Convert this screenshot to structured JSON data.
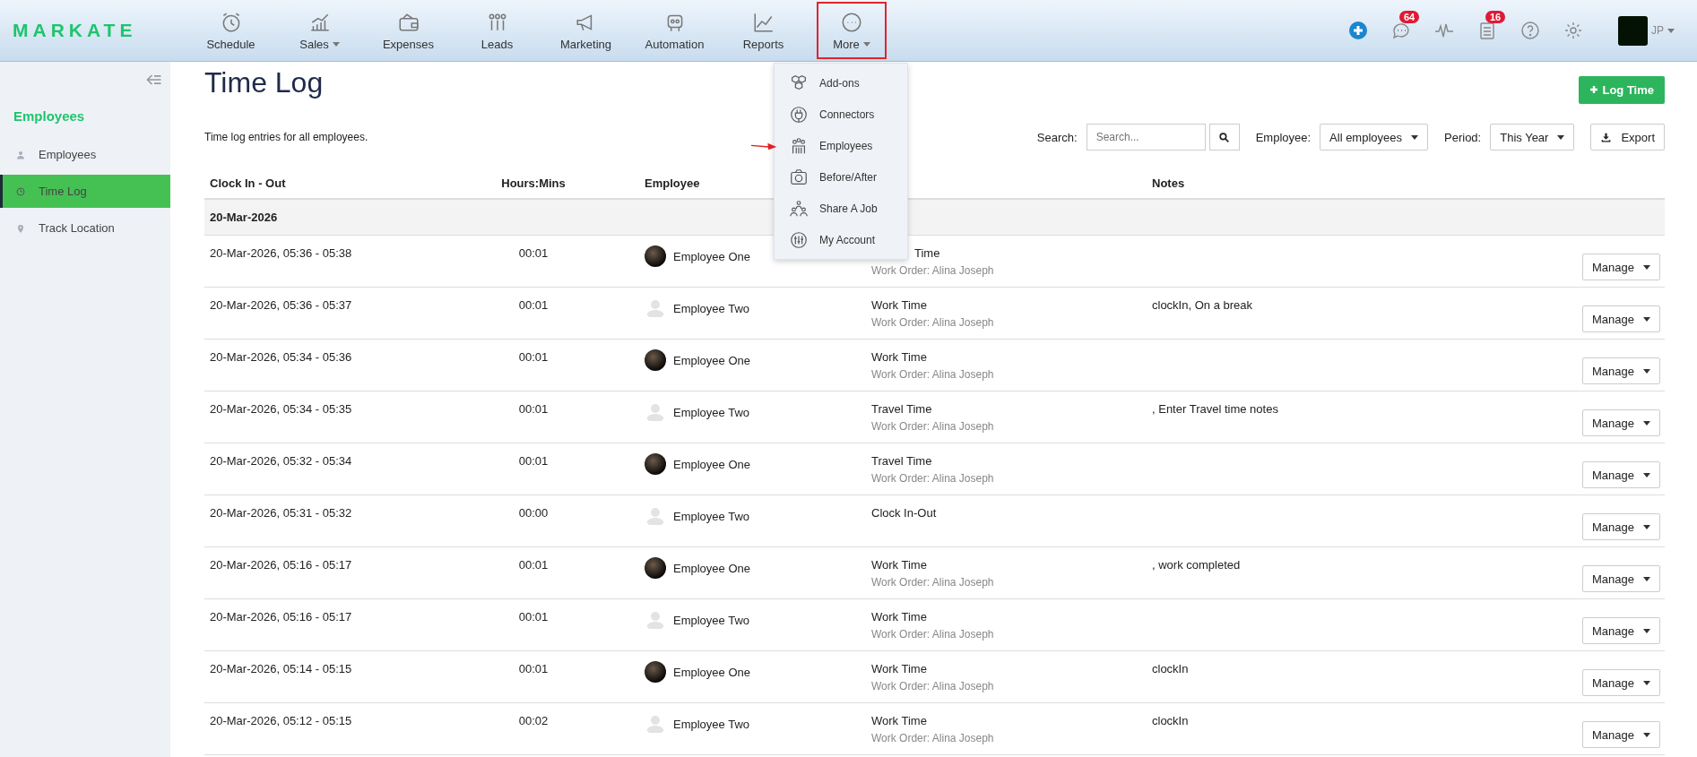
{
  "logo": "MARKATE",
  "nav": [
    {
      "label": "Schedule",
      "dropdown": false,
      "highlighted": false
    },
    {
      "label": "Sales",
      "dropdown": true,
      "highlighted": false
    },
    {
      "label": "Expenses",
      "dropdown": false,
      "highlighted": false
    },
    {
      "label": "Leads",
      "dropdown": false,
      "highlighted": false
    },
    {
      "label": "Marketing",
      "dropdown": false,
      "highlighted": false
    },
    {
      "label": "Automation",
      "dropdown": false,
      "highlighted": false
    },
    {
      "label": "Reports",
      "dropdown": false,
      "highlighted": false
    },
    {
      "label": "More",
      "dropdown": true,
      "highlighted": true
    }
  ],
  "header_right": {
    "chat_badge": "64",
    "tasks_badge": "16",
    "user": "JP"
  },
  "more_menu": [
    {
      "label": "Add-ons",
      "pointed": false
    },
    {
      "label": "Connectors",
      "pointed": false
    },
    {
      "label": "Employees",
      "pointed": true
    },
    {
      "label": "Before/After",
      "pointed": false
    },
    {
      "label": "Share A Job",
      "pointed": false
    },
    {
      "label": "My Account",
      "pointed": false
    }
  ],
  "sidebar": {
    "title": "Employees",
    "items": [
      {
        "label": "Employees",
        "selected": false
      },
      {
        "label": "Time Log",
        "selected": true
      },
      {
        "label": "Track Location",
        "selected": false
      }
    ]
  },
  "page": {
    "title": "Time Log",
    "subtitle": "Time log entries for all employees.",
    "log_button": "Log Time"
  },
  "filters": {
    "search_label": "Search:",
    "search_placeholder": "Search...",
    "employee_label": "Employee:",
    "employee_value": "All employees",
    "period_label": "Period:",
    "period_value": "This Year",
    "export": "Export"
  },
  "table": {
    "columns": [
      "Clock In - Out",
      "Hours:Mins",
      "Employee",
      "Notes"
    ],
    "group": "20-Mar-2026",
    "rows": [
      {
        "time": "20-Mar-2026, 05:36 - 05:38",
        "hours": "00:01",
        "employee": "Employee One",
        "photo": true,
        "type": "Time",
        "type_partial": true,
        "work_order": "Work Order: Alina Joseph",
        "notes": "",
        "action": "Manage"
      },
      {
        "time": "20-Mar-2026, 05:36 - 05:37",
        "hours": "00:01",
        "employee": "Employee Two",
        "photo": false,
        "type": "Work Time",
        "type_partial": false,
        "work_order": "Work Order: Alina Joseph",
        "notes": "clockIn, On a break",
        "action": "Manage"
      },
      {
        "time": "20-Mar-2026, 05:34 - 05:36",
        "hours": "00:01",
        "employee": "Employee One",
        "photo": true,
        "type": "Work Time",
        "type_partial": false,
        "work_order": "Work Order: Alina Joseph",
        "notes": "",
        "action": "Manage"
      },
      {
        "time": "20-Mar-2026, 05:34 - 05:35",
        "hours": "00:01",
        "employee": "Employee Two",
        "photo": false,
        "type": "Travel Time",
        "type_partial": false,
        "work_order": "Work Order: Alina Joseph",
        "notes": ", Enter Travel time notes",
        "action": "Manage"
      },
      {
        "time": "20-Mar-2026, 05:32 - 05:34",
        "hours": "00:01",
        "employee": "Employee One",
        "photo": true,
        "type": "Travel Time",
        "type_partial": false,
        "work_order": "Work Order: Alina Joseph",
        "notes": "",
        "action": "Manage"
      },
      {
        "time": "20-Mar-2026, 05:31 - 05:32",
        "hours": "00:00",
        "employee": "Employee Two",
        "photo": false,
        "type": "Clock In-Out",
        "type_partial": false,
        "work_order": "",
        "notes": "",
        "action": "Manage"
      },
      {
        "time": "20-Mar-2026, 05:16 - 05:17",
        "hours": "00:01",
        "employee": "Employee One",
        "photo": true,
        "type": "Work Time",
        "type_partial": false,
        "work_order": "Work Order: Alina Joseph",
        "notes": ", work completed",
        "action": "Manage"
      },
      {
        "time": "20-Mar-2026, 05:16 - 05:17",
        "hours": "00:01",
        "employee": "Employee Two",
        "photo": false,
        "type": "Work Time",
        "type_partial": false,
        "work_order": "Work Order: Alina Joseph",
        "notes": "",
        "action": "Manage"
      },
      {
        "time": "20-Mar-2026, 05:14 - 05:15",
        "hours": "00:01",
        "employee": "Employee One",
        "photo": true,
        "type": "Work Time",
        "type_partial": false,
        "work_order": "Work Order: Alina Joseph",
        "notes": "clockIn",
        "action": "Manage"
      },
      {
        "time": "20-Mar-2026, 05:12 - 05:15",
        "hours": "00:02",
        "employee": "Employee Two",
        "photo": false,
        "type": "Work Time",
        "type_partial": false,
        "work_order": "Work Order: Alina Joseph",
        "notes": "clockIn",
        "action": "Manage"
      }
    ]
  }
}
